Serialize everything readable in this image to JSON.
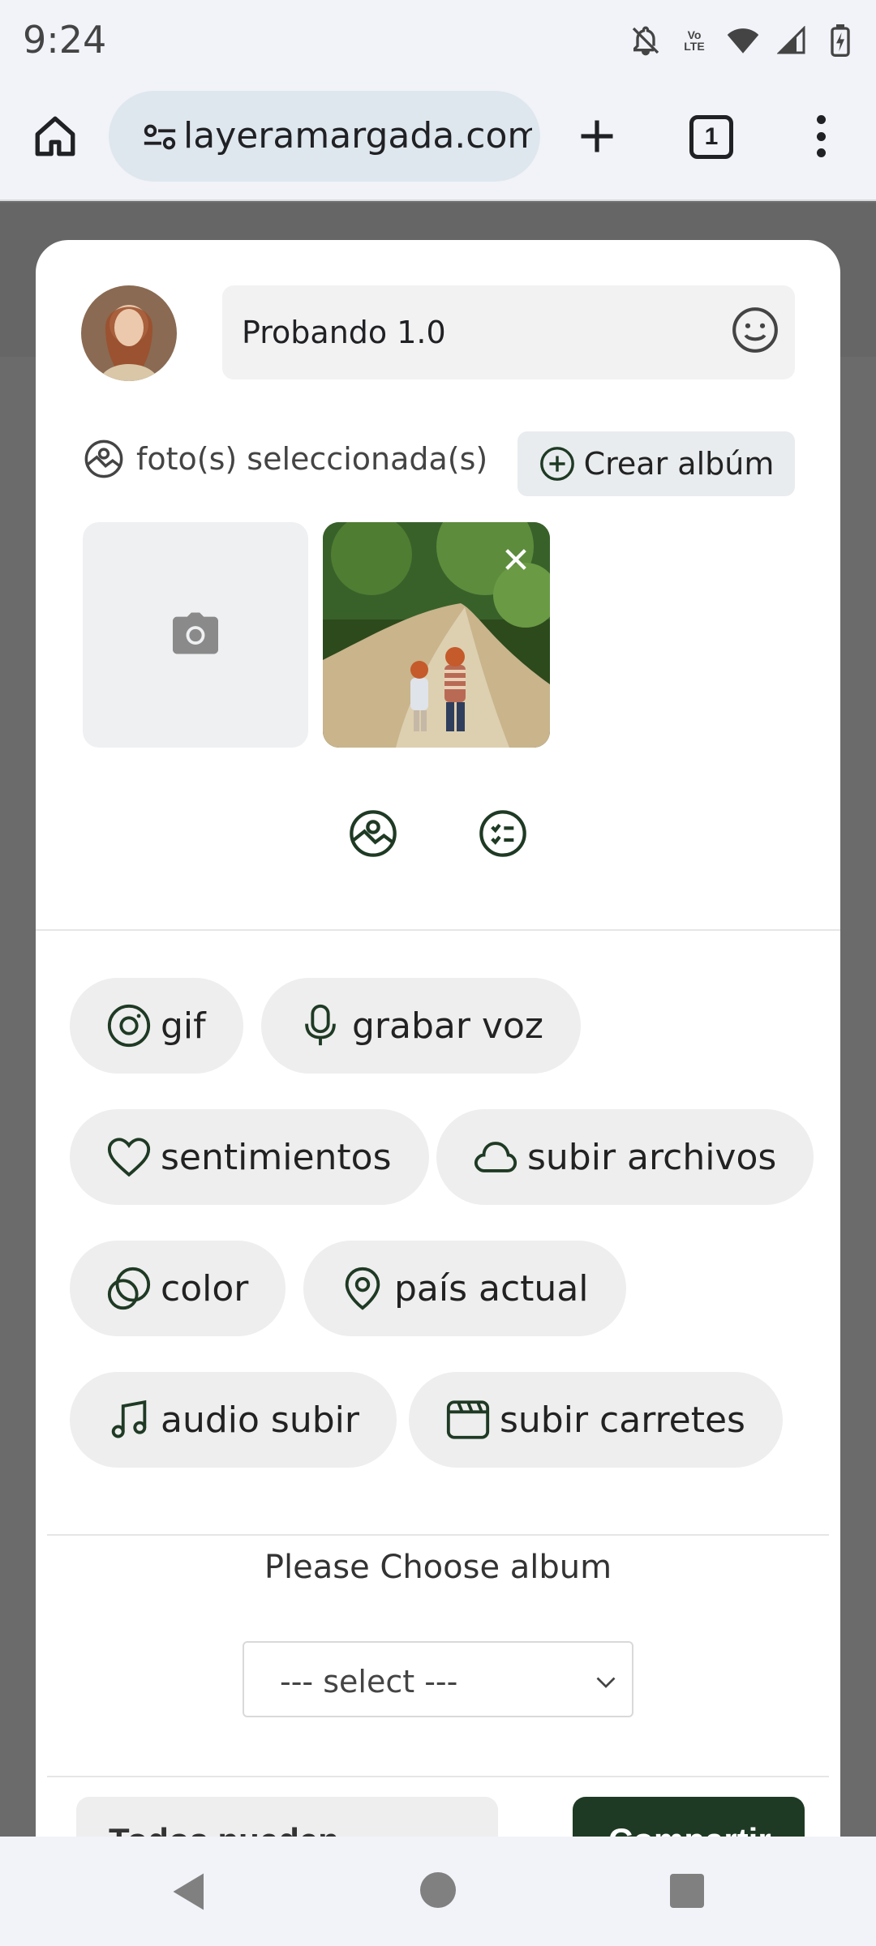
{
  "status_bar": {
    "time": "9:24",
    "volte_label": "Vo LTE",
    "icons": [
      "bell-off-icon",
      "volte-icon",
      "wifi-icon",
      "signal-icon",
      "battery-charging-icon"
    ]
  },
  "browser": {
    "url": "layeramargada.com",
    "tab_count": "1",
    "icons": [
      "home-icon",
      "site-settings-icon",
      "plus-icon",
      "more-vert-icon"
    ]
  },
  "composer": {
    "post_text": "Probando 1.0",
    "photos_label": "foto(s) seleccionada(s)",
    "create_album_label": "Crear albúm",
    "options": {
      "gif": "gif",
      "voice": "grabar voz",
      "feelings": "sentimientos",
      "upload_files": "subir archivos",
      "color": "color",
      "country": "país actual",
      "audio": "audio subir",
      "reels": "subir carretes"
    },
    "album_label": "Please Choose album",
    "album_select_value": "--- select ---",
    "bottom_left_label": "Todos pueden",
    "bottom_right_label": "Compartir"
  },
  "colors": {
    "accent_dark_green": "#1f3a24",
    "chip_background": "#eeeeee",
    "icon_stroke": "#1f3a24"
  }
}
